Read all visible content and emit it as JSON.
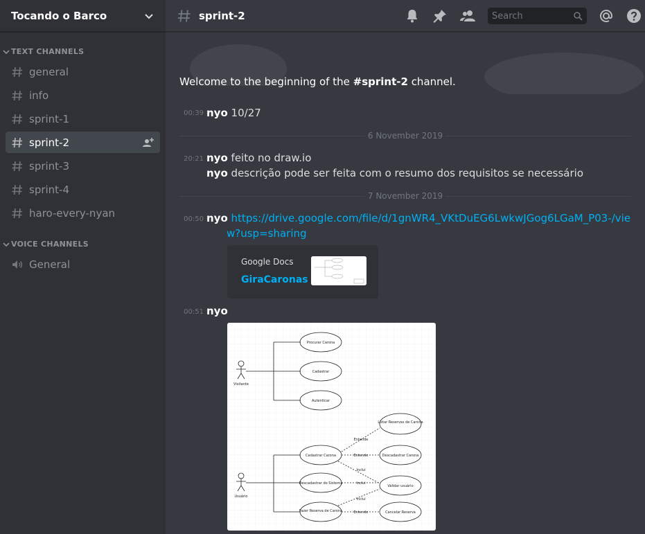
{
  "guild": {
    "name": "Tocando o Barco"
  },
  "categories": {
    "text": "TEXT CHANNELS",
    "voice": "VOICE CHANNELS"
  },
  "text_channels": [
    {
      "name": "general"
    },
    {
      "name": "info"
    },
    {
      "name": "sprint-1"
    },
    {
      "name": "sprint-2"
    },
    {
      "name": "sprint-3"
    },
    {
      "name": "sprint-4"
    },
    {
      "name": "haro-every-nyan"
    }
  ],
  "voice_channels": [
    {
      "name": "General"
    }
  ],
  "header": {
    "channel": "sprint-2",
    "search_placeholder": "Search"
  },
  "welcome": {
    "prefix": "Welcome to the beginning of the ",
    "channel": "#sprint-2",
    "suffix": " channel."
  },
  "messages": [
    {
      "time": "00:39",
      "author": "nyo",
      "text": "10/27"
    },
    {
      "time": "20:21",
      "author": "nyo",
      "text": "feito no draw.io"
    },
    {
      "author": "nyo",
      "text": "descrição pode ser feita com o resumo dos requisitos se necessário"
    },
    {
      "time": "00:50",
      "author": "nyo",
      "link_line1": "https://drive.google.com/file/d/1gnWR4_VKtDuEG6LwkwJGog6LGaM_P03-/vie",
      "link_line2": "w?usp=sharing"
    },
    {
      "time": "00:51",
      "author": "nyo"
    }
  ],
  "dividers": [
    "6 November 2019",
    "7 November 2019"
  ],
  "embed": {
    "provider": "Google Docs",
    "title": "GiraCaronas"
  },
  "diagram": {
    "actors": [
      "Visitante",
      "Usuário"
    ],
    "use_cases": [
      "Procurar Carona",
      "Cadastrar",
      "Autenticar",
      "Listar Reservas de Carona",
      "Cadastrar Carona",
      "Descadastrar Carona",
      "Descadastrar do Sistema",
      "Validar usuário",
      "Fazer Reserva de Carona",
      "Cancelar Reserva"
    ],
    "relations": [
      "Entende",
      "Entende",
      "Inclui",
      "Inclui",
      "Inclui",
      "Entende"
    ]
  },
  "colors": {
    "sidebar": "#2f3136",
    "chat": "#36393f",
    "link": "#00b0f4",
    "active_channel": "#42464d"
  }
}
